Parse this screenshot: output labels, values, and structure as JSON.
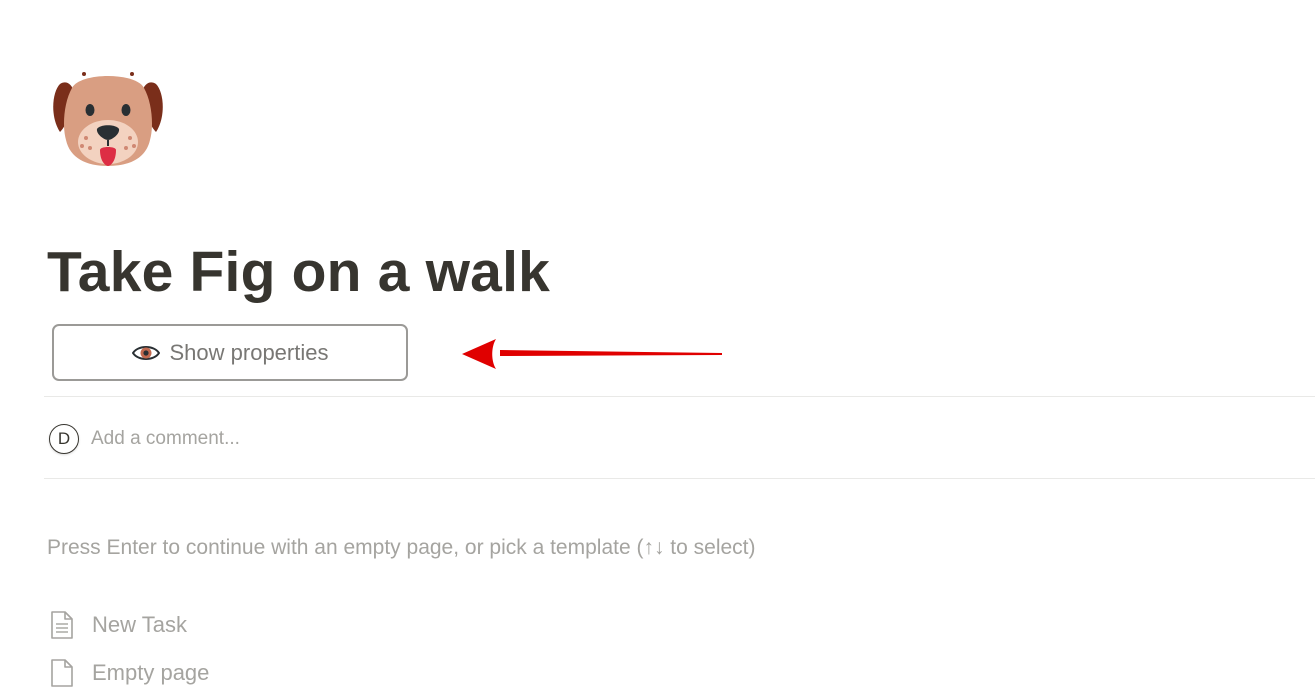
{
  "page": {
    "icon": "dog-face-icon",
    "title": "Take Fig on a walk"
  },
  "properties_toggle": {
    "icon": "eye-icon",
    "label": "Show properties"
  },
  "annotation": {
    "type": "red-arrow-pointing-left",
    "color": "#e00000"
  },
  "comment": {
    "avatar_initial": "D",
    "placeholder": "Add a comment..."
  },
  "template_prompt": {
    "hint": "Press Enter to continue with an empty page, or pick a template (↑↓ to select)",
    "items": [
      {
        "icon": "document-lines-icon",
        "label": "New Task"
      },
      {
        "icon": "blank-page-icon",
        "label": "Empty page"
      }
    ]
  },
  "colors": {
    "title": "#37352f",
    "muted_text": "#a5a4a0",
    "button_border": "#9b9a97",
    "divider": "#e9e9e7",
    "arrow": "#e00000"
  }
}
